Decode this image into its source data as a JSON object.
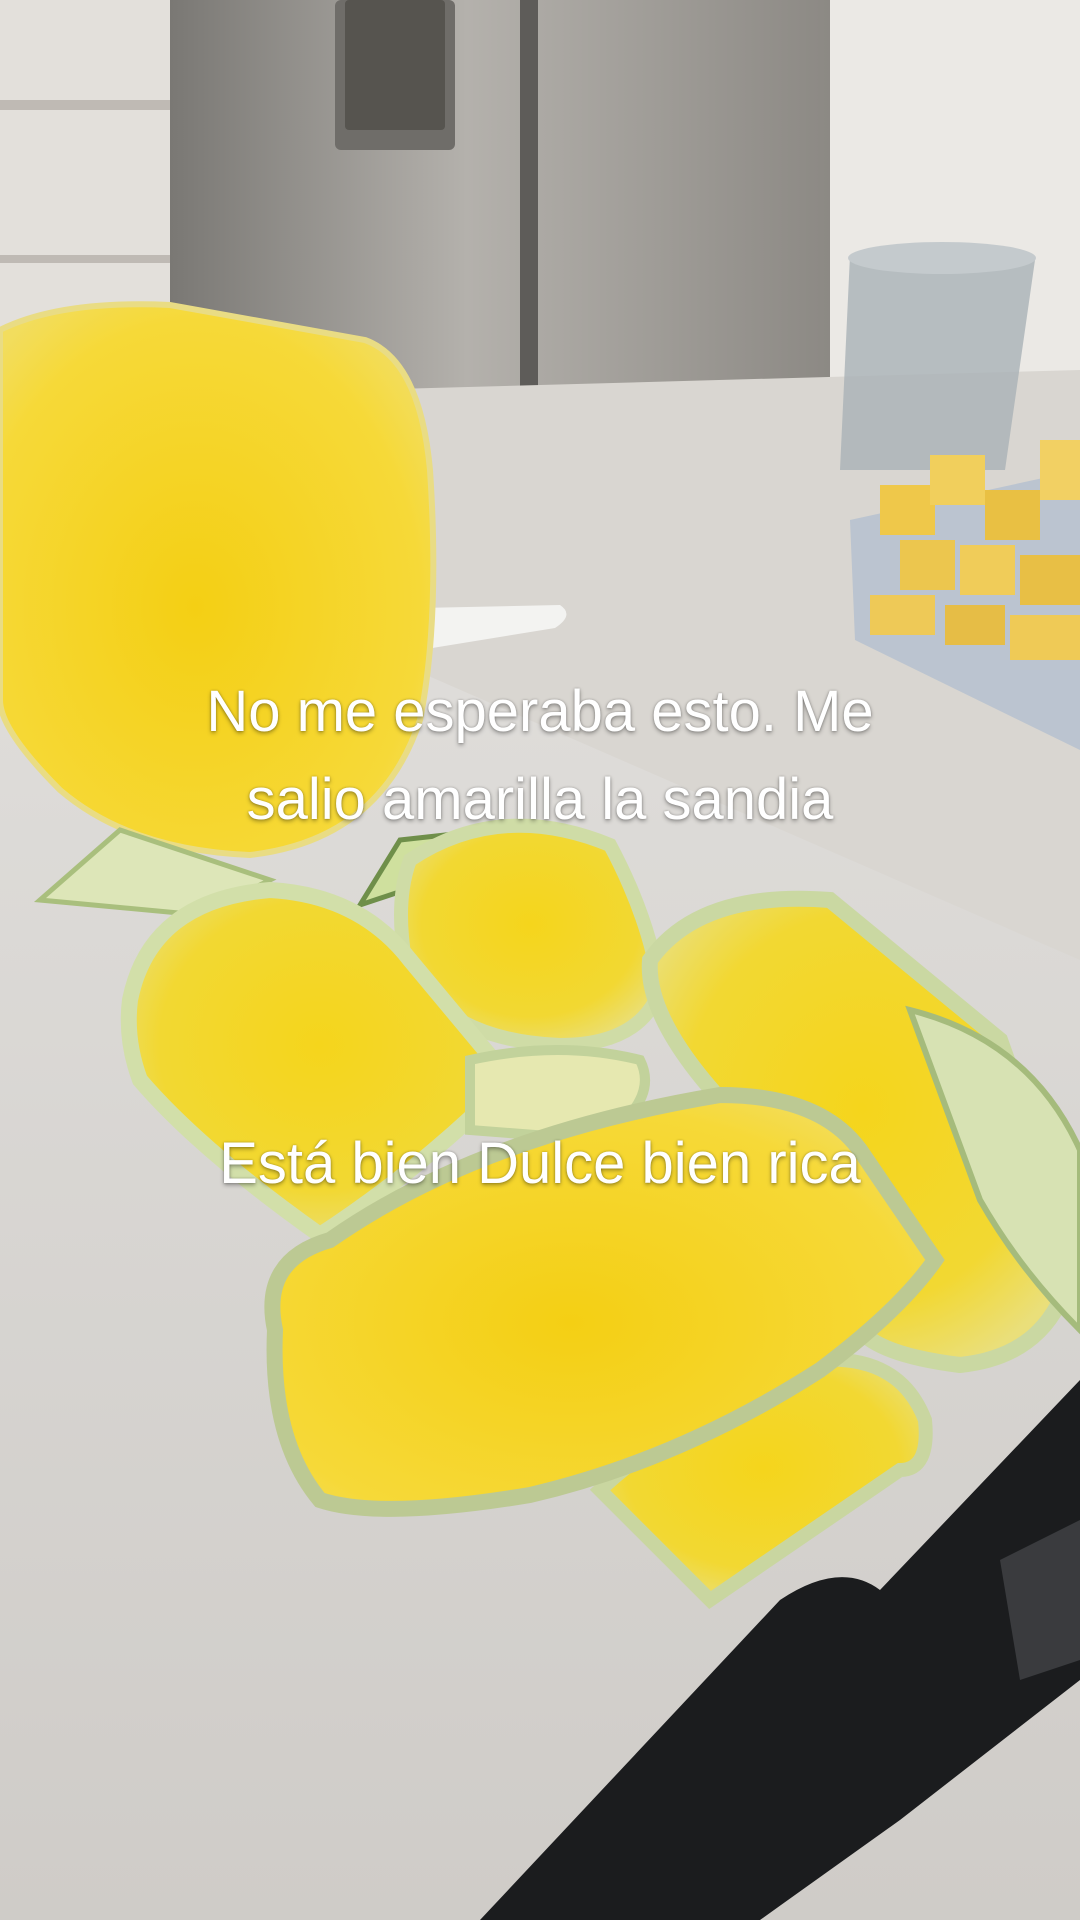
{
  "captions": {
    "top": {
      "line1": "No me esperaba esto. Me",
      "line2": "salio amarilla la sandia"
    },
    "bottom": {
      "line1": "Está bien Dulce bien rica"
    }
  },
  "palette": {
    "flesh": "#f2d21f",
    "flesh_light": "#f8e35a",
    "rind": "#c9d7a6",
    "rind_dark": "#8fa86a",
    "counter": "#d6d3cf",
    "board": "#e4e2df",
    "knife": "#1b1c1e"
  }
}
